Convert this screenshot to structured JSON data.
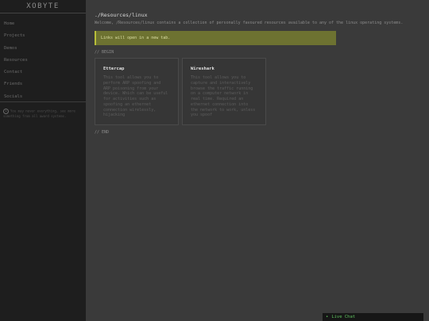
{
  "sidebar": {
    "logo": "XOBYTE",
    "items": [
      {
        "label": "Home"
      },
      {
        "label": "Projects"
      },
      {
        "label": "Demos"
      },
      {
        "label": "Resources"
      },
      {
        "label": "Contact"
      },
      {
        "label": "Friends"
      },
      {
        "label": "Socials"
      }
    ],
    "note": "You may never everything, see more something from all award systems."
  },
  "main": {
    "title": "./Resources/linux",
    "welcome": "Welcome, /Resources/linux contains a collection of personally favoured resources available to any of the linux operating systems.",
    "alert": "Links will open in a new tab.",
    "begin": "// BEGIN",
    "end": "// END",
    "cards": [
      {
        "title": "Ettercap",
        "description": "This tool allows you to perform ARP spoofing and ARP poisoning from your device. Which can be useful for activities such as spoofing an ethernet connection wirelessly, hijacking"
      },
      {
        "title": "Wireshark",
        "description": "This tool allows you to capture and interactively browse the traffic running on a computer network in real time. Required an ethernet connection into the network to work, unless you spoof"
      }
    ]
  },
  "chat": {
    "dot": "•",
    "label": "Live Chat"
  },
  "colors": {
    "accent": "#b8be3a",
    "alert_bg": "#6d7231",
    "chat_text": "#5ec15e"
  }
}
